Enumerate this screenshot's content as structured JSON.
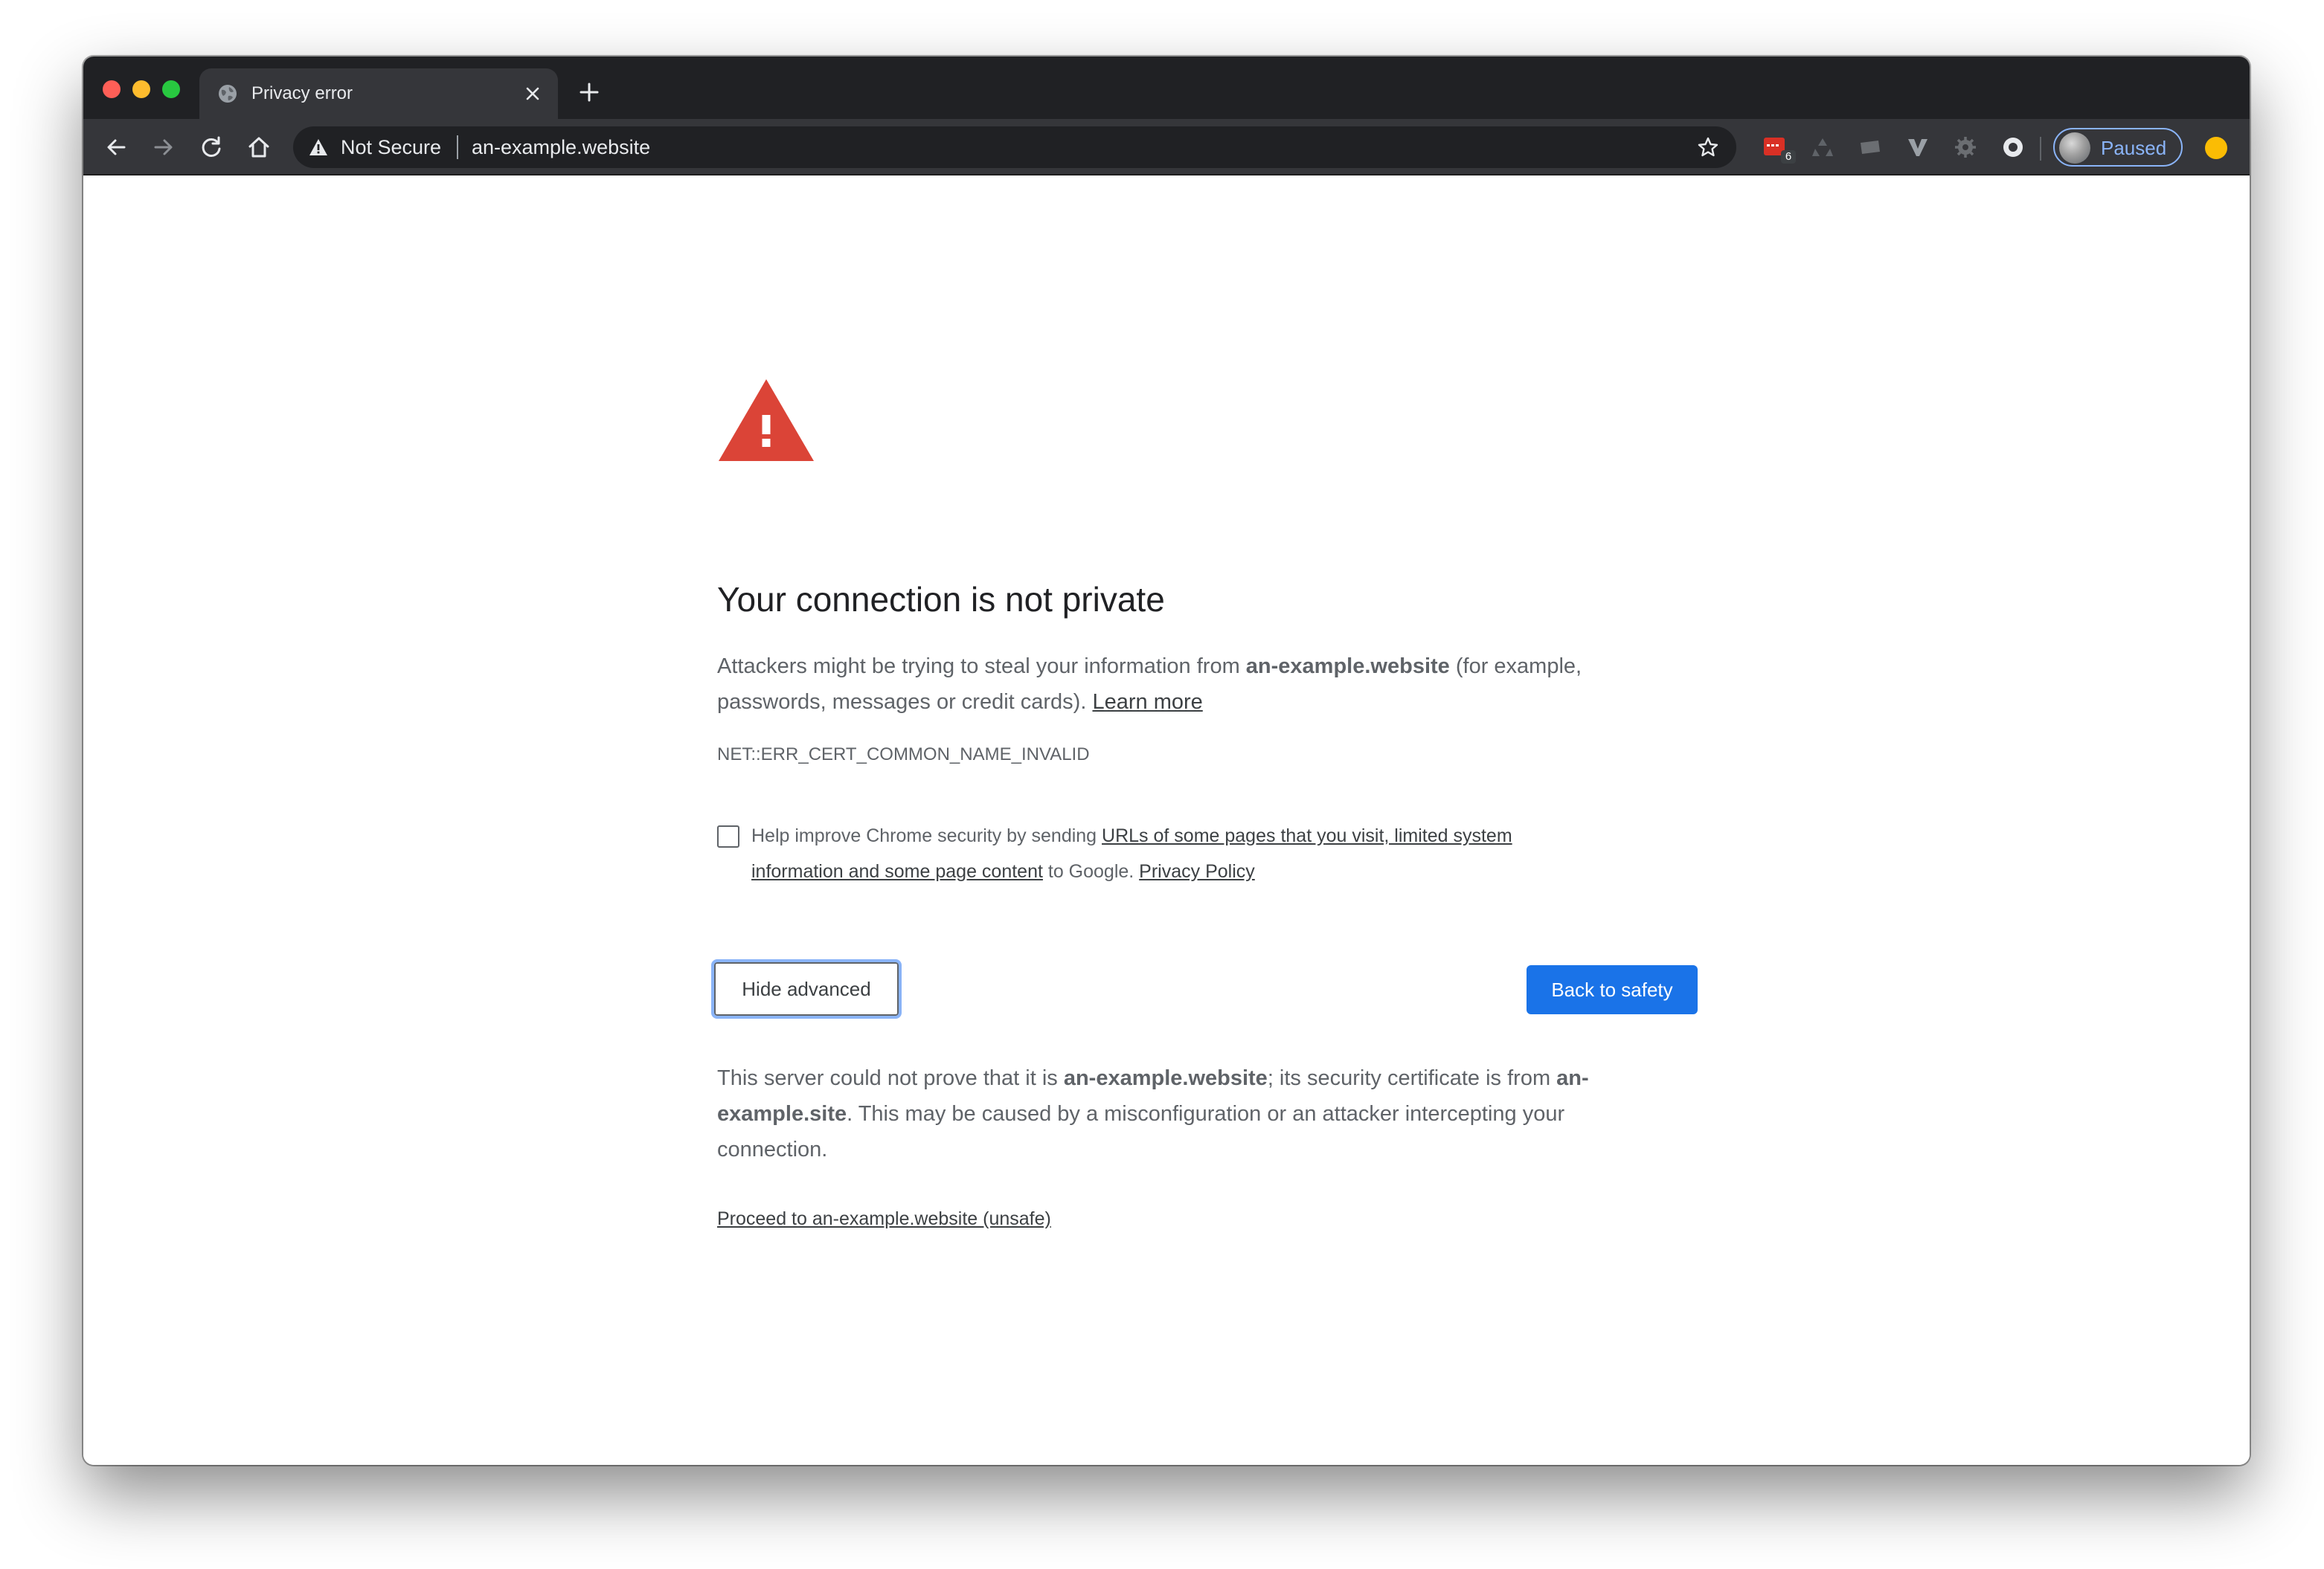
{
  "tab": {
    "title": "Privacy error",
    "favicon": "globe-icon"
  },
  "toolbar": {
    "security_label": "Not Secure",
    "url": "an-example.website",
    "extension_badge": "6",
    "profile_status": "Paused"
  },
  "page": {
    "heading": "Your connection is not private",
    "intro": {
      "before": "Attackers might be trying to steal your information from ",
      "host": "an-example.website",
      "after": " (for example, passwords, messages or credit cards). ",
      "learn_more": "Learn more"
    },
    "error_code": "NET::ERR_CERT_COMMON_NAME_INVALID",
    "opt_in": {
      "before": "Help improve Chrome security by sending ",
      "link": "URLs of some pages that you visit, limited system information and some page content",
      "middle": " to Google. ",
      "privacy_policy": "Privacy Policy",
      "checked": false
    },
    "hide_advanced": "Hide advanced",
    "back_to_safety": "Back to safety",
    "details": {
      "part1": "This server could not prove that it is ",
      "host": "an-example.website",
      "part2": "; its security certificate is from ",
      "cert_host": "an-example.site",
      "part3": ". This may be caused by a misconfiguration or an attacker intercepting your connection."
    },
    "proceed_link": "Proceed to an-example.website (unsafe)"
  },
  "colors": {
    "frame": "#202124",
    "toolbar": "#35363a",
    "warning_red": "#db4437",
    "primary_button": "#1a73e8",
    "focus_ring": "#8ab4f8",
    "update_badge": "#fbbc04"
  }
}
